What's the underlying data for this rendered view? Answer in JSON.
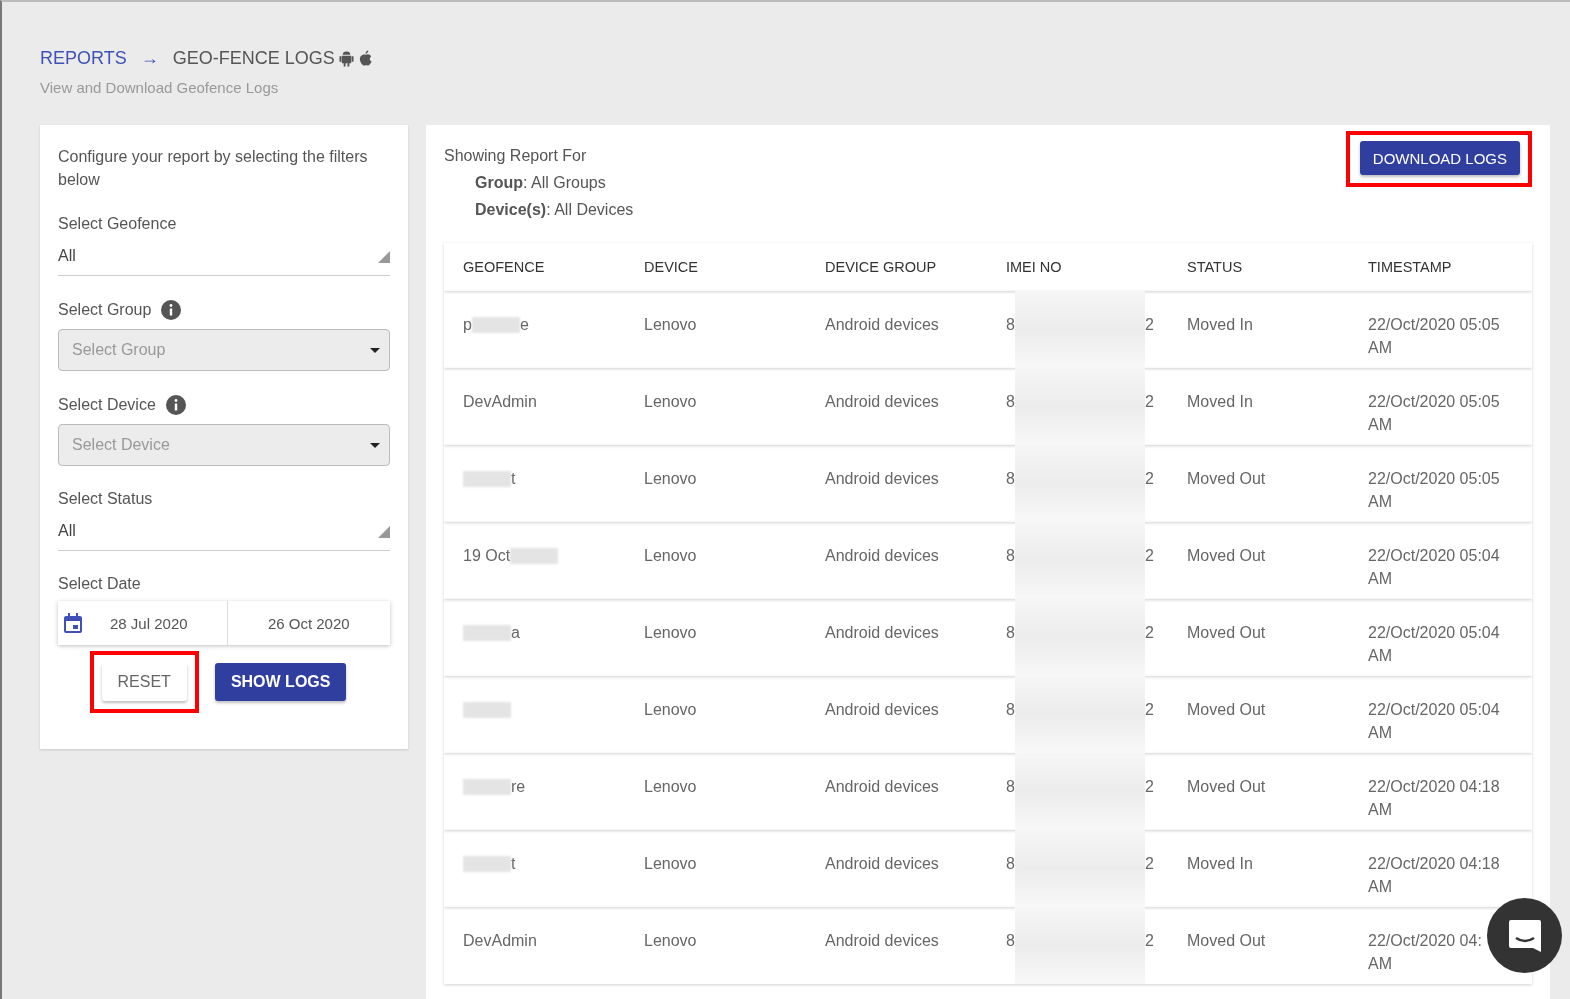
{
  "breadcrumb": {
    "parent": "REPORTS",
    "separator": "→",
    "current": "GEO-FENCE LOGS"
  },
  "subtitle": "View and Download Geofence Logs",
  "filters": {
    "intro": "Configure your report by selecting the filters below",
    "fields": [
      {
        "kind": "select",
        "label": "Select Geofence",
        "value": "All"
      },
      {
        "kind": "dropdown",
        "label": "Select Group",
        "placeholder": "Select Group",
        "info": true
      },
      {
        "kind": "dropdown",
        "label": "Select Device",
        "placeholder": "Select Device",
        "info": true
      },
      {
        "kind": "select",
        "label": "Select Status",
        "value": "All"
      },
      {
        "kind": "daterange",
        "label": "Select Date",
        "from": "28 Jul 2020",
        "to": "26 Oct 2020"
      }
    ],
    "buttons": [
      {
        "label": "RESET",
        "kind": "secondary",
        "highlighted": true
      },
      {
        "label": "SHOW LOGS",
        "kind": "primary"
      }
    ]
  },
  "report": {
    "heading": "Showing Report For",
    "details": [
      "**Group**: All Groups",
      "**Device(s)**: All Devices"
    ],
    "download_button": {
      "label": "DOWNLOAD LOGS",
      "highlighted": true
    },
    "columns": [
      "GEOFENCE",
      "DEVICE",
      "DEVICE GROUP",
      "IMEI NO",
      "STATUS",
      "TIMESTAMP"
    ],
    "rows": [
      {
        "geofence": [
          {
            "kind": "text",
            "text": "p"
          },
          {
            "kind": "redacted"
          },
          {
            "kind": "text",
            "text": "e"
          }
        ],
        "device": "Lenovo",
        "group": "Android devices",
        "imei": [
          "8",
          "2"
        ],
        "status": "Moved In",
        "timestamp": [
          "22/Oct/2020 05:05",
          "AM"
        ]
      },
      {
        "geofence": [
          {
            "kind": "text",
            "text": "DevAdmin"
          }
        ],
        "device": "Lenovo",
        "group": "Android devices",
        "imei": [
          "8",
          "2"
        ],
        "status": "Moved In",
        "timestamp": [
          "22/Oct/2020 05:05",
          "AM"
        ]
      },
      {
        "geofence": [
          {
            "kind": "redacted"
          },
          {
            "kind": "text",
            "text": "t"
          }
        ],
        "device": "Lenovo",
        "group": "Android devices",
        "imei": [
          "8",
          "2"
        ],
        "status": "Moved Out",
        "timestamp": [
          "22/Oct/2020 05:05",
          "AM"
        ]
      },
      {
        "geofence": [
          {
            "kind": "text",
            "text": "19 Oct"
          },
          {
            "kind": "redacted"
          }
        ],
        "device": "Lenovo",
        "group": "Android devices",
        "imei": [
          "8",
          "2"
        ],
        "status": "Moved Out",
        "timestamp": [
          "22/Oct/2020 05:04",
          "AM"
        ]
      },
      {
        "geofence": [
          {
            "kind": "redacted"
          },
          {
            "kind": "text",
            "text": "a"
          }
        ],
        "device": "Lenovo",
        "group": "Android devices",
        "imei": [
          "8",
          "2"
        ],
        "status": "Moved Out",
        "timestamp": [
          "22/Oct/2020 05:04",
          "AM"
        ]
      },
      {
        "geofence": [
          {
            "kind": "redacted"
          }
        ],
        "device": "Lenovo",
        "group": "Android devices",
        "imei": [
          "8",
          "2"
        ],
        "status": "Moved Out",
        "timestamp": [
          "22/Oct/2020 05:04",
          "AM"
        ]
      },
      {
        "geofence": [
          {
            "kind": "redacted"
          },
          {
            "kind": "text",
            "text": "re"
          }
        ],
        "device": "Lenovo",
        "group": "Android devices",
        "imei": [
          "8",
          "2"
        ],
        "status": "Moved Out",
        "timestamp": [
          "22/Oct/2020 04:18",
          "AM"
        ]
      },
      {
        "geofence": [
          {
            "kind": "redacted"
          },
          {
            "kind": "text",
            "text": "t"
          }
        ],
        "device": "Lenovo",
        "group": "Android devices",
        "imei": [
          "8",
          "2"
        ],
        "status": "Moved In",
        "timestamp": [
          "22/Oct/2020 04:18",
          "AM"
        ]
      },
      {
        "geofence": [
          {
            "kind": "text",
            "text": "DevAdmin"
          }
        ],
        "device": "Lenovo",
        "group": "Android devices",
        "imei": [
          "8",
          "2"
        ],
        "status": "Moved Out",
        "timestamp": [
          "22/Oct/2020 04:",
          "AM"
        ]
      }
    ]
  }
}
